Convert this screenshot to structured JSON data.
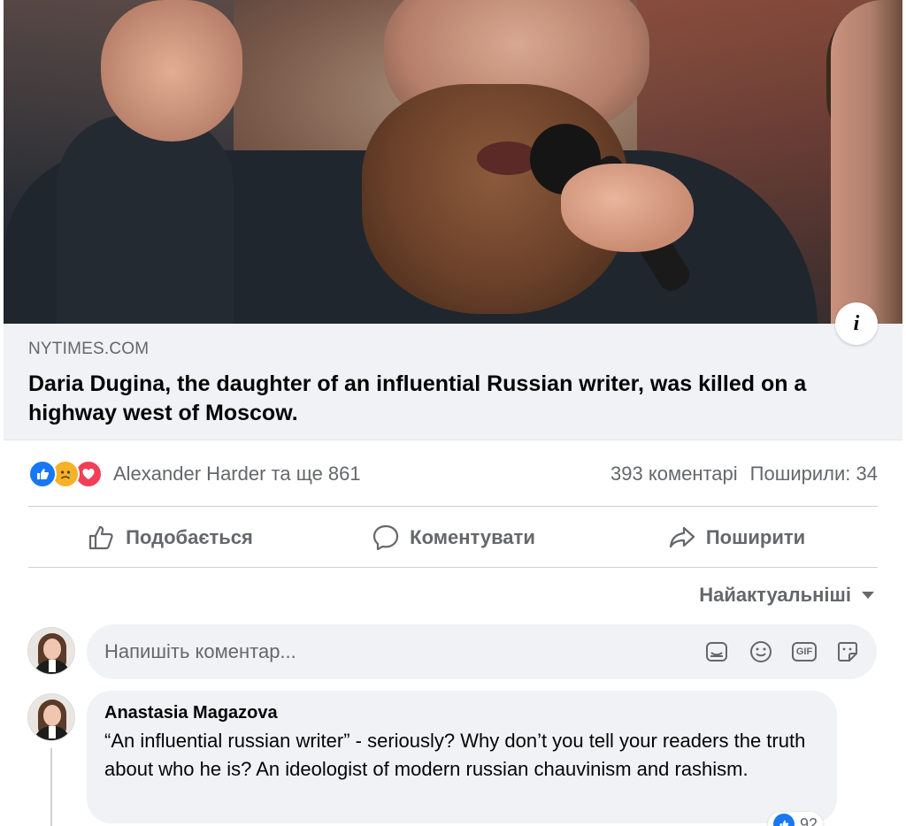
{
  "link_preview": {
    "image_description_icon": "info-icon",
    "domain": "NYTIMES.COM",
    "headline": "Daria Dugina, the daughter of an influential Russian writer, was killed on a highway west of Moscow."
  },
  "stats": {
    "reaction_icons": [
      "like-icon",
      "sad-icon",
      "love-icon"
    ],
    "reactors": "Alexander Harder та ще 861",
    "comments": "393 коментарі",
    "shares": "Поширили: 34"
  },
  "actions": {
    "like": "Подобається",
    "comment": "Коментувати",
    "share": "Поширити"
  },
  "sort": {
    "label": "Найактуальніші"
  },
  "composer": {
    "placeholder": "Напишіть коментар...",
    "icons": [
      "sticker-icon",
      "emoji-icon",
      "gif-icon",
      "avatar-sticker-icon"
    ],
    "gif_label": "GIF"
  },
  "comments": [
    {
      "author": "Anastasia Magazova",
      "text": "“An influential russian writer” - seriously? Why don’t you tell your readers the truth about who he is? An ideologist of modern russian chauvinism and rashism.",
      "reaction_count": "92"
    }
  ],
  "colors": {
    "accent": "#1877f2",
    "secondary_text": "#65676b",
    "bubble": "#f0f2f5"
  }
}
